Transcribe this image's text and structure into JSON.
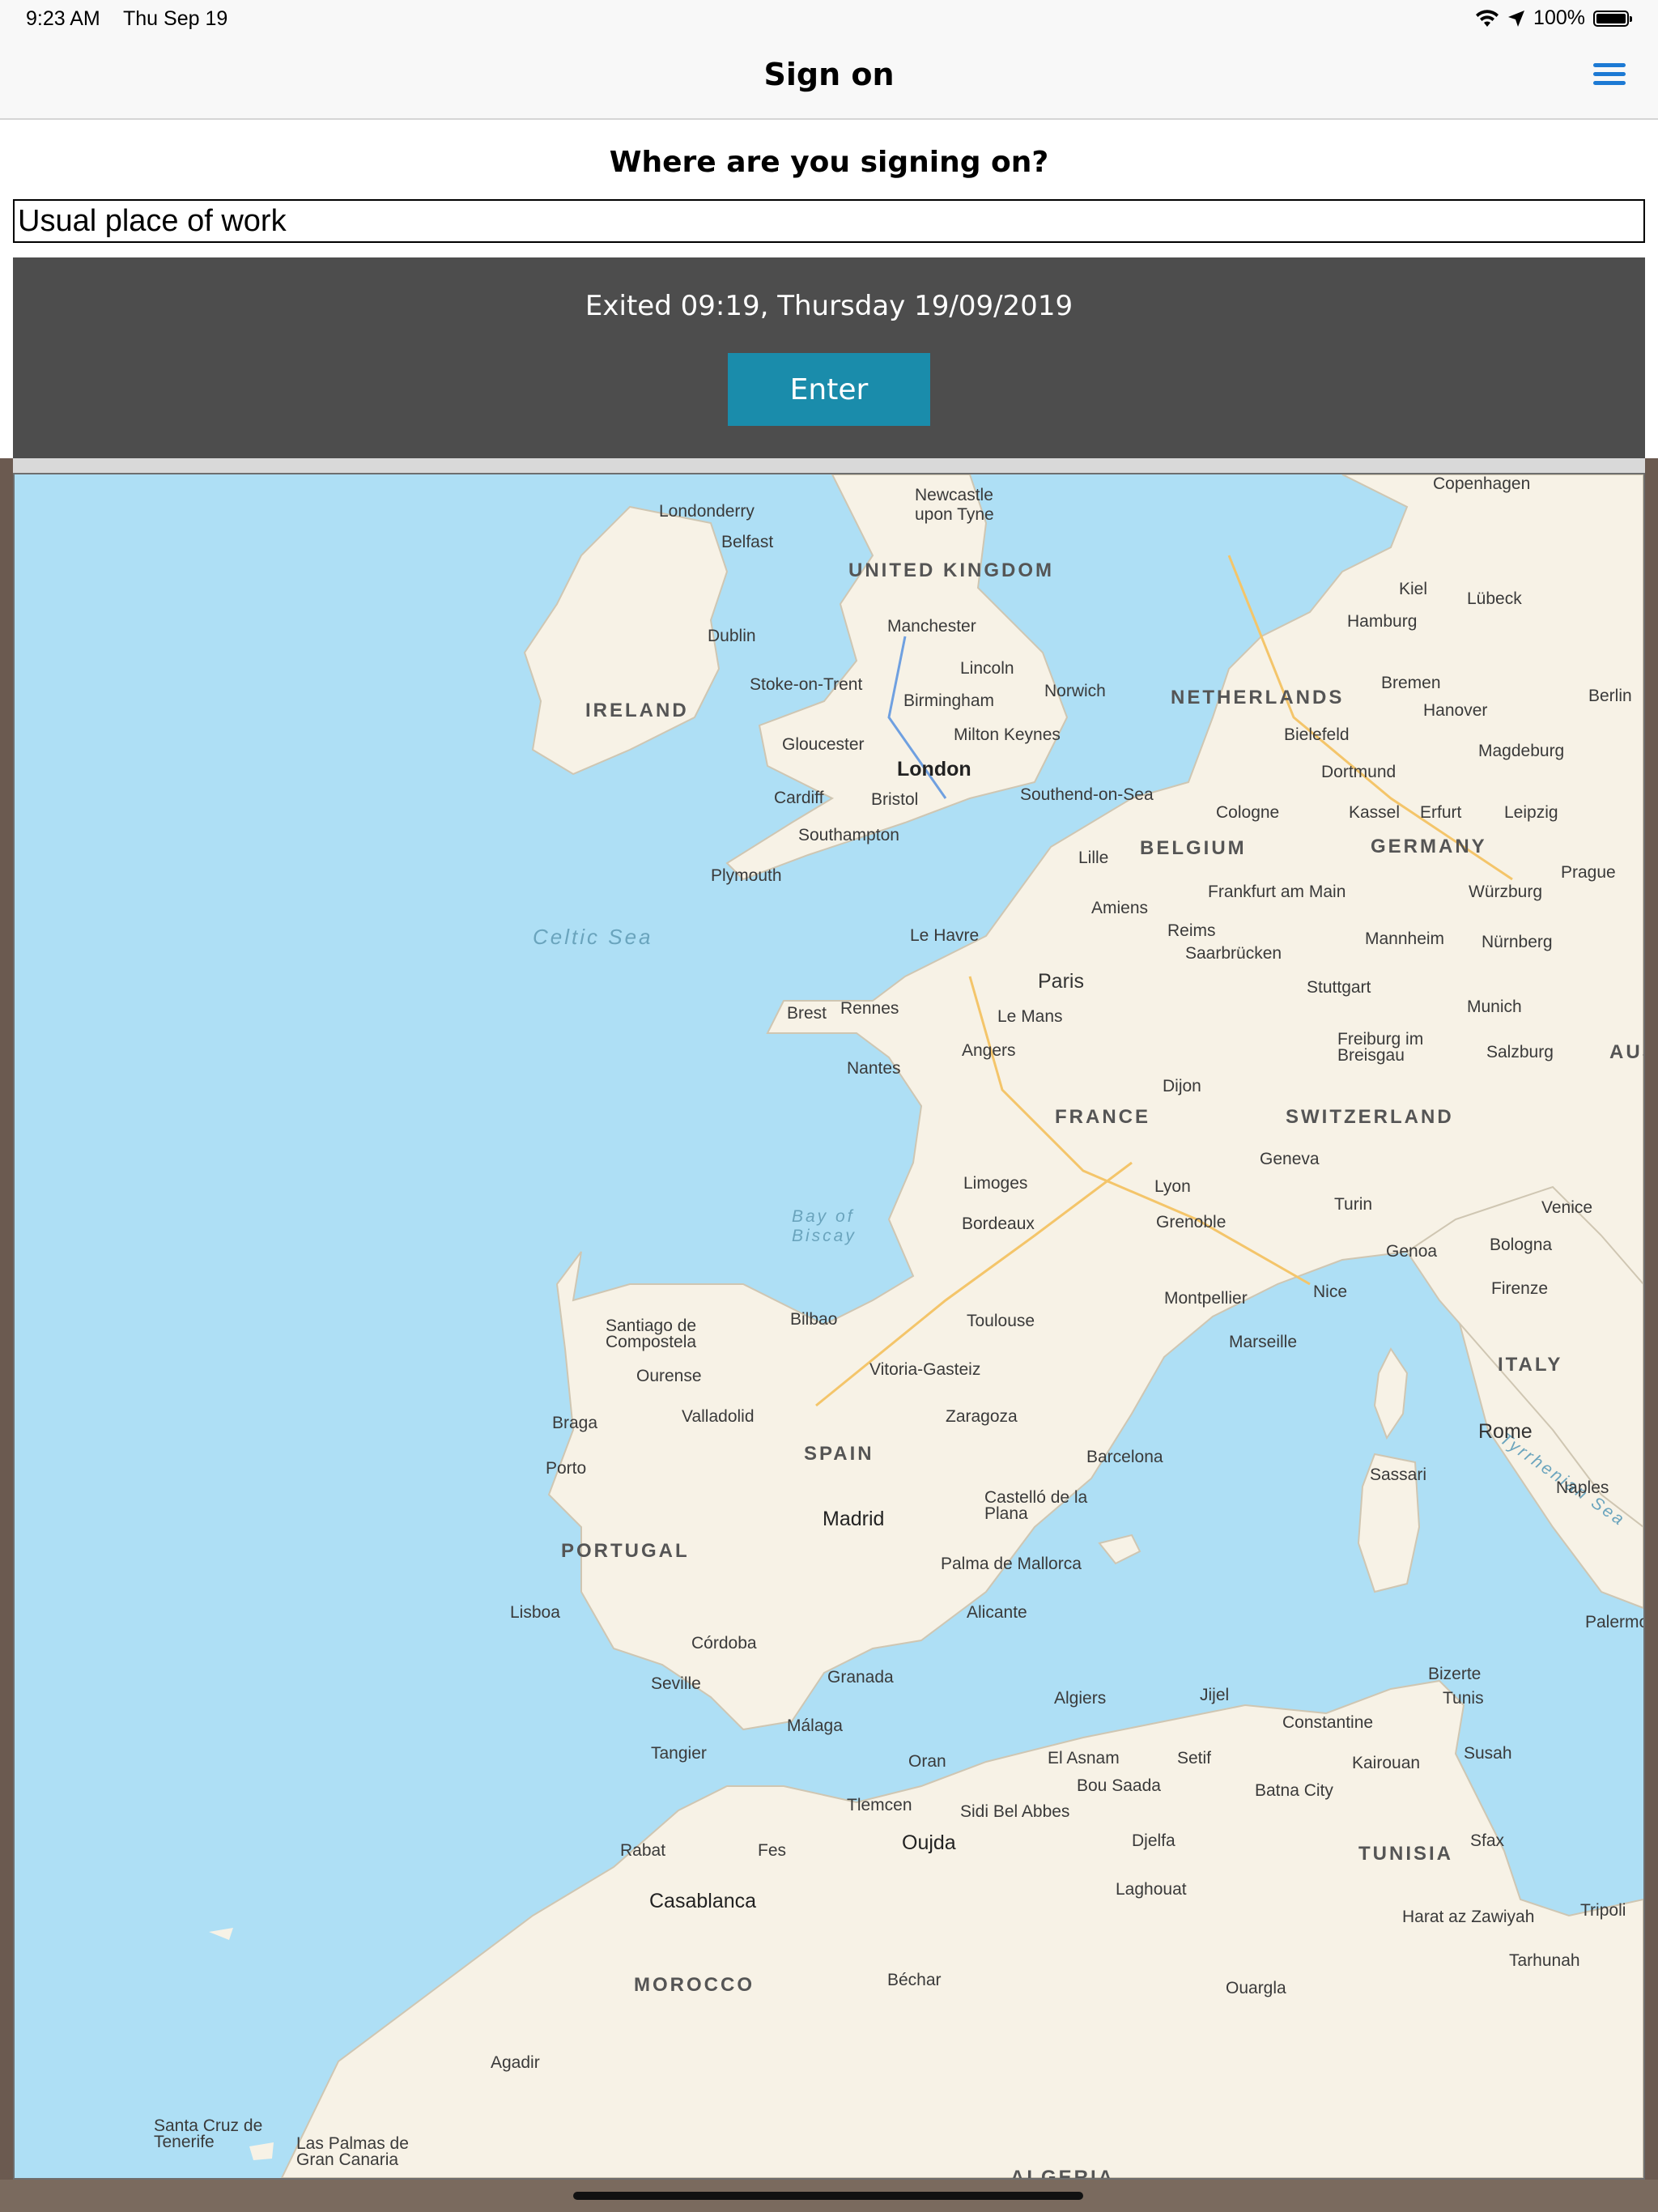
{
  "status_bar": {
    "time": "9:23 AM",
    "date": "Thu Sep 19",
    "battery": "100%"
  },
  "nav": {
    "title": "Sign on"
  },
  "form": {
    "question": "Where are you signing on?",
    "location_value": "Usual place of work"
  },
  "panel": {
    "status_text": "Exited 09:19, Thursday 19/09/2019",
    "enter_label": "Enter"
  },
  "colors": {
    "accent": "#1a8cab",
    "menu_icon": "#1d7ad4",
    "panel_bg": "#4d4d4d",
    "water": "#aedff5",
    "land": "#f7f2e6"
  },
  "map": {
    "countries": [
      "UNITED KINGDOM",
      "IRELAND",
      "NETHERLANDS",
      "BELGIUM",
      "GERMANY",
      "FRANCE",
      "SWITZERLAND",
      "ITALY",
      "SPAIN",
      "PORTUGAL",
      "MOROCCO",
      "TUNISIA",
      "ALGERIA",
      "AUS"
    ],
    "seas": [
      "Celtic Sea",
      "Bay of Biscay",
      "Tyrrhenian Sea"
    ],
    "cities": [
      "Londonderry",
      "Belfast",
      "Newcastle upon Tyne",
      "Dublin",
      "Manchester",
      "Lincoln",
      "Stoke-on-Trent",
      "Birmingham",
      "Norwich",
      "Milton Keynes",
      "Gloucester",
      "London",
      "Cardiff",
      "Bristol",
      "Southend-on-Sea",
      "Southampton",
      "Plymouth",
      "Copenhagen",
      "Kiel",
      "Lübeck",
      "Hamburg",
      "Bremen",
      "Berlin",
      "Hanover",
      "Bielefeld",
      "Magdeburg",
      "Dortmund",
      "Cologne",
      "Kassel",
      "Erfurt",
      "Leipzig",
      "Lille",
      "Frankfurt am Main",
      "Würzburg",
      "Prague",
      "Amiens",
      "Reims",
      "Mannheim",
      "Nürnberg",
      "Le Havre",
      "Saarbrücken",
      "Paris",
      "Stuttgart",
      "Munich",
      "Brest",
      "Rennes",
      "Le Mans",
      "Freiburg im Breisgau",
      "Salzburg",
      "Angers",
      "Nantes",
      "Dijon",
      "Geneva",
      "Limoges",
      "Lyon",
      "Turin",
      "Venice",
      "Grenoble",
      "Bordeaux",
      "Genoa",
      "Bologna",
      "Firenze",
      "Montpellier",
      "Nice",
      "Marseille",
      "Toulouse",
      "Bilbao",
      "Santiago de Compostela",
      "Vitoria-Gasteiz",
      "Ourense",
      "Valladolid",
      "Zaragoza",
      "Braga",
      "Porto",
      "Barcelona",
      "Rome",
      "Sassari",
      "Naples",
      "Madrid",
      "Castelló de la Plana",
      "Palma de Mallorca",
      "Lisboa",
      "Alicante",
      "Córdoba",
      "Palermo",
      "Seville",
      "Granada",
      "Málaga",
      "Algiers",
      "Jijel",
      "Bizerte",
      "Tunis",
      "Constantine",
      "Tangier",
      "Oran",
      "El Asnam",
      "Setif",
      "Kairouan",
      "Susah",
      "Bou Saada",
      "Batna City",
      "Tlemcen",
      "Sidi Bel Abbes",
      "Oujda",
      "Djelfa",
      "Sfax",
      "Rabat",
      "Fes",
      "Laghouat",
      "Casablanca",
      "Harat az Zawiyah",
      "Tripoli",
      "Tarhunah",
      "Béchar",
      "Ouargla",
      "Agadir",
      "Santa Cruz de Tenerife",
      "Las Palmas de Gran Canaria"
    ]
  }
}
